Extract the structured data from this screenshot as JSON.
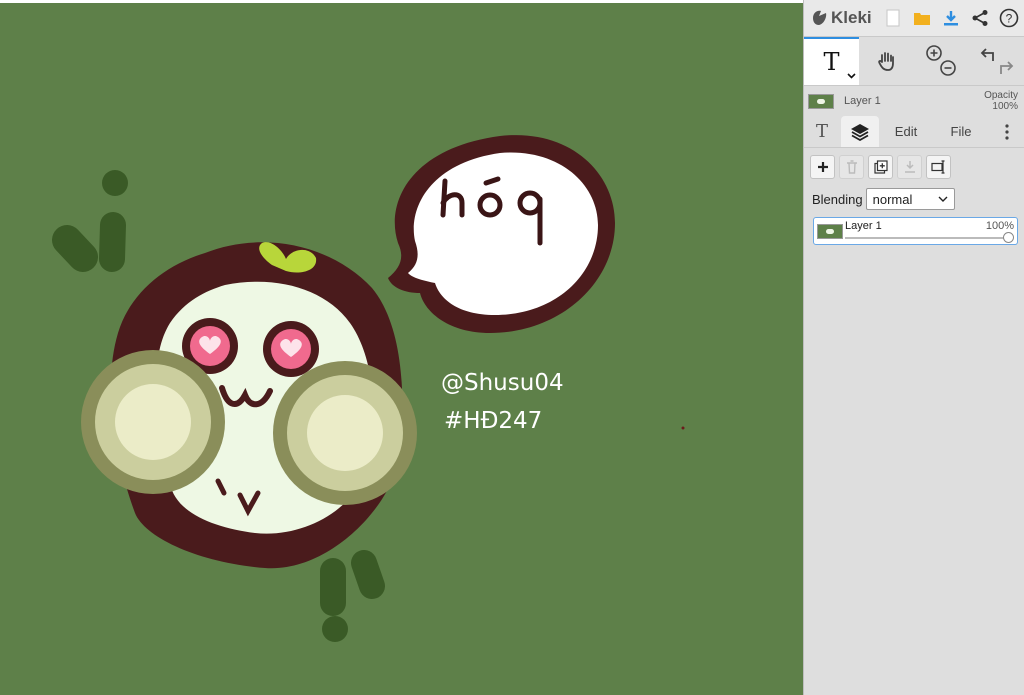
{
  "canvas": {
    "background": "#5e8049",
    "art_text": {
      "handle": "@Shusu04",
      "tag": "#HĐ247"
    }
  },
  "sidebar": {
    "app_name": "Kleki",
    "active_tool_glyph": "T",
    "preview": {
      "layer_name": "Layer 1",
      "opacity_label": "Opacity",
      "opacity_value": "100%"
    },
    "tabs": {
      "text_glyph": "T",
      "edit": "Edit",
      "file": "File"
    },
    "blending": {
      "label": "Blending",
      "value": "normal"
    },
    "layers": [
      {
        "name": "Layer 1",
        "opacity": "100%",
        "opacity_fraction": 1.0
      }
    ]
  },
  "colors": {
    "accent": "#2e8ee0",
    "download": "#2e8ee0",
    "folder": "#f2b01e",
    "canvas": "#5e8049"
  }
}
